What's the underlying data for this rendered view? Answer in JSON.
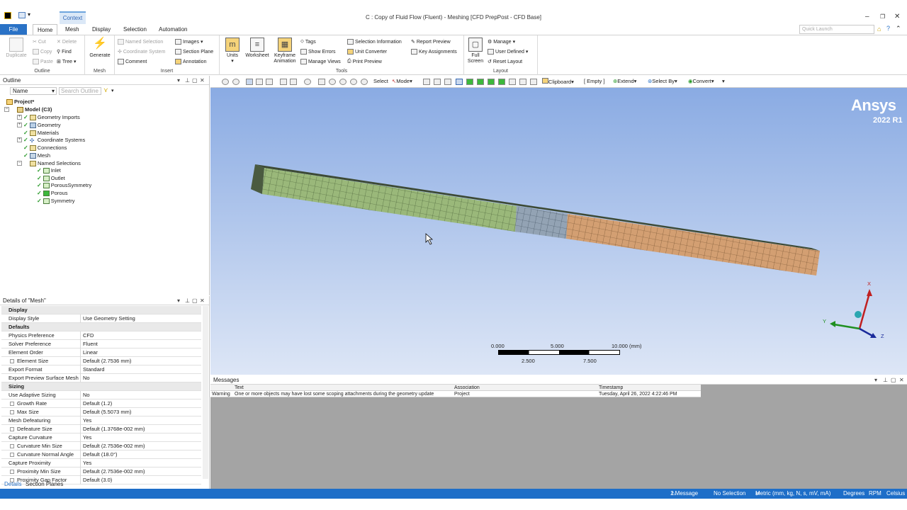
{
  "window": {
    "title": "C : Copy of Fluid Flow (Fluent) - Meshing [CFD PrepPost - CFD Base]",
    "context_tab": "Context"
  },
  "tabs": [
    "File",
    "Home",
    "Mesh",
    "Display",
    "Selection",
    "Automation"
  ],
  "quick_launch": "Quick Launch",
  "ribbon": {
    "outline_group": {
      "label": "Outline",
      "duplicate": "Duplicate",
      "cut": "Cut",
      "copy": "Copy",
      "paste": "Paste",
      "delete": "Delete",
      "find": "Find",
      "tree": "Tree"
    },
    "mesh_group": {
      "label": "Mesh",
      "generate": "Generate"
    },
    "insert_group": {
      "label": "Insert",
      "named_selection": "Named Selection",
      "coordinate_system": "Coordinate System",
      "comment": "Comment",
      "images": "Images",
      "section_plane": "Section Plane",
      "annotation": "Annotation"
    },
    "tools_group": {
      "label": "Tools",
      "units": "Units",
      "worksheet": "Worksheet",
      "keyframe": "Keyframe Animation",
      "tags": "Tags",
      "show_errors": "Show Errors",
      "manage_views": "Manage Views",
      "selection_information": "Selection Information",
      "unit_converter": "Unit Converter",
      "print_preview": "Print Preview",
      "report_preview": "Report Preview",
      "key_assignments": "Key Assignments"
    },
    "layout_group": {
      "label": "Layout",
      "full_screen": "Full Screen",
      "manage": "Manage",
      "user_defined": "User Defined",
      "reset_layout": "Reset Layout"
    }
  },
  "outline": {
    "title": "Outline",
    "filter_name": "Name",
    "search_placeholder": "Search Outline",
    "items": [
      {
        "label": "Project*",
        "level": 0
      },
      {
        "label": "Model (C3)",
        "level": 1
      },
      {
        "label": "Geometry Imports",
        "level": 2
      },
      {
        "label": "Geometry",
        "level": 2
      },
      {
        "label": "Materials",
        "level": 2
      },
      {
        "label": "Coordinate Systems",
        "level": 2
      },
      {
        "label": "Connections",
        "level": 2
      },
      {
        "label": "Mesh",
        "level": 2
      },
      {
        "label": "Named Selections",
        "level": 2
      },
      {
        "label": "Inlet",
        "level": 3
      },
      {
        "label": "Outlet",
        "level": 3
      },
      {
        "label": "PorousSymmetry",
        "level": 3
      },
      {
        "label": "Porous",
        "level": 3
      },
      {
        "label": "Symmetry",
        "level": 3
      }
    ]
  },
  "details": {
    "title": "Details of \"Mesh\"",
    "rows": [
      {
        "type": "section",
        "label": "Display"
      },
      {
        "label": "Display Style",
        "value": "Use Geometry Setting"
      },
      {
        "type": "section",
        "label": "Defaults"
      },
      {
        "label": "Physics Preference",
        "value": "CFD"
      },
      {
        "label": "Solver Preference",
        "value": "Fluent"
      },
      {
        "label": "Element Order",
        "value": "Linear"
      },
      {
        "label": "Element Size",
        "value": "Default (2.7536 mm)",
        "indent": true
      },
      {
        "label": "Export Format",
        "value": "Standard"
      },
      {
        "label": "Export Preview Surface Mesh",
        "value": "No"
      },
      {
        "type": "section",
        "label": "Sizing"
      },
      {
        "label": "Use Adaptive Sizing",
        "value": "No"
      },
      {
        "label": "Growth Rate",
        "value": "Default (1.2)",
        "indent": true
      },
      {
        "label": "Max Size",
        "value": "Default (5.5073 mm)",
        "indent": true
      },
      {
        "label": "Mesh Defeaturing",
        "value": "Yes"
      },
      {
        "label": "Defeature Size",
        "value": "Default (1.3768e-002 mm)",
        "indent": true
      },
      {
        "label": "Capture Curvature",
        "value": "Yes"
      },
      {
        "label": "Curvature Min Size",
        "value": "Default (2.7536e-002 mm)",
        "indent": true
      },
      {
        "label": "Curvature Normal Angle",
        "value": "Default (18.0°)",
        "indent": true
      },
      {
        "label": "Capture Proximity",
        "value": "Yes"
      },
      {
        "label": "Proximity Min Size",
        "value": "Default (2.7536e-002 mm)",
        "indent": true
      },
      {
        "label": "Proximity Gap Factor",
        "value": "Default (3.0)",
        "indent": true
      }
    ],
    "tabs": [
      "Details",
      "Section Planes"
    ]
  },
  "graphics_toolbar": {
    "select": "Select",
    "mode": "Mode",
    "clipboard": "Clipboard",
    "empty": "[ Empty ]",
    "extend": "Extend",
    "select_by": "Select By",
    "convert": "Convert"
  },
  "viewport": {
    "brand": "Ansys",
    "version": "2022 R1",
    "scale_labels_top": [
      "0.000",
      "5.000",
      "10.000 (mm)"
    ],
    "scale_labels_bottom": [
      "2.500",
      "7.500"
    ],
    "axes": {
      "x": "X",
      "y": "Y",
      "z": "Z"
    },
    "colors": {
      "green_region": "#9ab87a",
      "blue_region": "#93a3b4",
      "orange_region": "#d39f72"
    }
  },
  "messages": {
    "title": "Messages",
    "columns": [
      "Text",
      "Association",
      "Timestamp"
    ],
    "rows": [
      {
        "type": "Warning",
        "text": "One or more objects may have lost some scoping attachments during the geometry update",
        "association": "Project",
        "timestamp": "Tuesday, April 26, 2022 4:22:46 PM"
      }
    ]
  },
  "status": {
    "messages": "1 Message",
    "selection": "No Selection",
    "units": "Metric (mm, kg, N, s, mV, mA)",
    "angle": "Degrees",
    "rpm": "RPM",
    "temp": "Celsius"
  }
}
